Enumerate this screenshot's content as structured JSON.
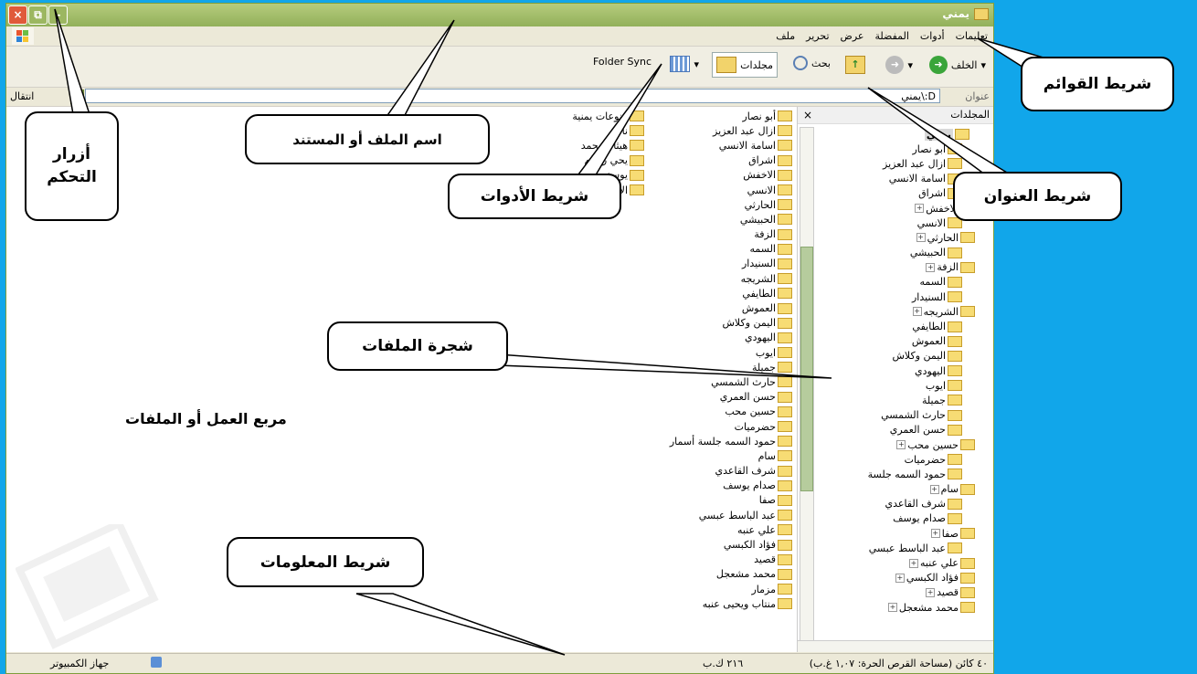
{
  "window": {
    "title": "يمني",
    "controls": {
      "close": "×",
      "restore": "⧉",
      "minimize": "–"
    }
  },
  "menu": {
    "items": [
      "ملف",
      "تحرير",
      "عرض",
      "المفضلة",
      "أدوات",
      "تعليمات"
    ]
  },
  "toolbar": {
    "back": "الخلف",
    "search": "بحث",
    "folders": "مجلدات",
    "folder_sync": "Folder Sync"
  },
  "address": {
    "label": "عنوان",
    "value": "D:\\يمني",
    "go": "انتقال"
  },
  "folders_pane": {
    "title": "المجلدات",
    "close": "×",
    "root": "يمني",
    "items": [
      {
        "label": "أبو نصار",
        "expand": false
      },
      {
        "label": "ازال عبد العزيز",
        "expand": false
      },
      {
        "label": "اسامة الانسي",
        "expand": false
      },
      {
        "label": "اشراق",
        "expand": false
      },
      {
        "label": "الاخفش",
        "expand": true
      },
      {
        "label": "الانسي",
        "expand": false
      },
      {
        "label": "الحارثي",
        "expand": true
      },
      {
        "label": "الحبيشي",
        "expand": false
      },
      {
        "label": "الزفة",
        "expand": true
      },
      {
        "label": "السمه",
        "expand": false
      },
      {
        "label": "السنيدار",
        "expand": false
      },
      {
        "label": "الشريجه",
        "expand": true
      },
      {
        "label": "الطايفي",
        "expand": false
      },
      {
        "label": "العموش",
        "expand": false
      },
      {
        "label": "اليمن وكلاش",
        "expand": false
      },
      {
        "label": "اليهودي",
        "expand": false
      },
      {
        "label": "ايوب",
        "expand": false
      },
      {
        "label": "جميلة",
        "expand": false
      },
      {
        "label": "حارث الشمسي",
        "expand": false
      },
      {
        "label": "حسن العمري",
        "expand": false
      },
      {
        "label": "حسين محب",
        "expand": true
      },
      {
        "label": "حضرميات",
        "expand": false
      },
      {
        "label": "حمود السمه جلسة",
        "expand": false
      },
      {
        "label": "سام",
        "expand": true
      },
      {
        "label": "شرف القاعدي",
        "expand": false
      },
      {
        "label": "صدام يوسف",
        "expand": false
      },
      {
        "label": "صفا",
        "expand": true
      },
      {
        "label": "عبد الباسط عبسي",
        "expand": false
      },
      {
        "label": "علي عنبه",
        "expand": true
      },
      {
        "label": "فؤاد الكبسي",
        "expand": true
      },
      {
        "label": "قصيد",
        "expand": true
      },
      {
        "label": "محمد مشعجل",
        "expand": true
      }
    ]
  },
  "files": {
    "column1": [
      "أبو نصار",
      "ازال عبد العزيز",
      "اسامة الانسي",
      "اشراق",
      "الاخفش",
      "الانسي",
      "الحارثي",
      "الحبيشي",
      "الزفة",
      "السمه",
      "السنيدار",
      "الشريجه",
      "الطايفي",
      "العموش",
      "اليمن وكلاش",
      "اليهودي",
      "ايوب",
      "جميلة",
      "حارث الشمسي",
      "حسن العمري",
      "حسين محب",
      "حضرميات",
      "حمود السمه جلسة أسمار",
      "سام",
      "شرف القاعدي",
      "صدام يوسف",
      "صفا",
      "عبد الباسط عبسي",
      "علي عنبه",
      "فؤاد الكبسي",
      "قصيد",
      "محمد مشعجل",
      "مزمار",
      "منتاب ويحيى عنبه"
    ],
    "column2": [
      "منوعات يمنية",
      "نادر",
      "هيثام محمد",
      "يحي رسام",
      "يوسف",
      "الألبوم"
    ]
  },
  "status": {
    "left": "٤٠ كائن (مساحة القرص الحرة: ١,٠٧ غ.ب)",
    "size": "٢١٦ ك.ب",
    "location": "جهاز الكمبيوتر"
  },
  "annotations": {
    "menubar": "شريط القوائم",
    "controls": "أزرار التحكم",
    "filename": "اسم الملف أو المستند",
    "toolbar": "شريط الأدوات",
    "addressbar": "شريط العنوان",
    "tree": "شجرة الملفات",
    "workarea": "مربع العمل أو الملفات",
    "statusbar": "شريط المعلومات"
  },
  "colors": {
    "background": "#11a6ea",
    "titlebar": "#9cb761"
  }
}
